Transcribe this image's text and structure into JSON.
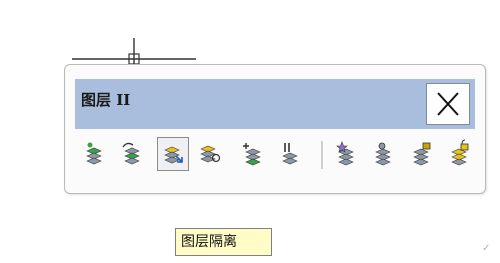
{
  "toolbar": {
    "title": "图层 II",
    "close_glyph": "×",
    "tools": [
      {
        "icon": "layer-match-icon",
        "pressed": false
      },
      {
        "icon": "layer-previous-icon",
        "pressed": false
      },
      {
        "icon": "layer-isolate-icon",
        "pressed": true
      },
      {
        "icon": "layer-unisolate-icon",
        "pressed": false
      },
      {
        "icon": "layer-change-to-current-icon",
        "pressed": false
      },
      {
        "icon": "layer-walk-icon",
        "pressed": false
      },
      {
        "icon": "layer-freeze-icon",
        "pressed": false
      },
      {
        "icon": "layer-off-icon",
        "pressed": false
      },
      {
        "icon": "layer-lock-icon",
        "pressed": false
      },
      {
        "icon": "layer-unlock-icon",
        "pressed": false
      }
    ]
  },
  "tooltip": {
    "text": "图层隔离"
  },
  "colors": {
    "titlebar": "#a9bedc",
    "tooltip_bg": "#fffcc7",
    "layer_green": "#3aa04a",
    "layer_yellow": "#e6c21e",
    "layer_gray": "#8d98a6"
  }
}
